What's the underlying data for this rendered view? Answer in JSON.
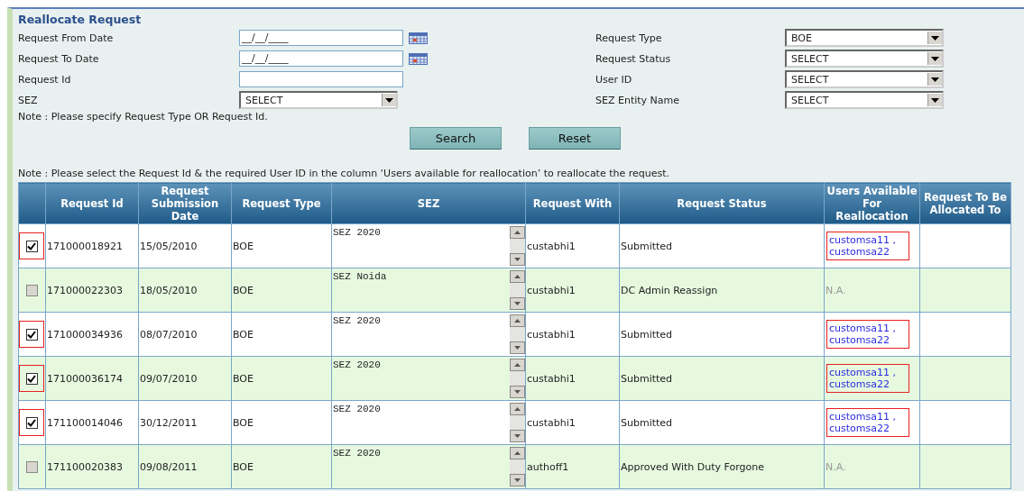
{
  "title": "Reallocate Request",
  "left_fields": [
    {
      "label": "Request From Date",
      "kind": "date",
      "value": "__/__/____"
    },
    {
      "label": "Request To Date",
      "kind": "date",
      "value": "__/__/____"
    },
    {
      "label": "Request Id",
      "kind": "text"
    },
    {
      "label": "SEZ",
      "kind": "select",
      "value": "SELECT"
    }
  ],
  "right_fields": [
    {
      "label": "Request Type",
      "kind": "select",
      "value": "BOE"
    },
    {
      "label": "Request Status",
      "kind": "select",
      "value": "SELECT"
    },
    {
      "label": "User ID",
      "kind": "select",
      "value": "SELECT"
    },
    {
      "label": "SEZ Entity Name",
      "kind": "select",
      "value": "SELECT"
    }
  ],
  "note_top": "Note : Please specify Request Type OR Request Id.",
  "buttons": [
    "Search",
    "Reset"
  ],
  "note_table": "Note : Please select the Request Id & the required User ID in the column ‘Users available for reallocation’ to reallocate the request.",
  "table": {
    "columns": [
      "Request Id",
      "Request Submission Date",
      "Request Type",
      "SEZ",
      "Request With",
      "Request Status",
      "Users Available For Reallocation",
      "Request To Be Allocated To"
    ],
    "rows": [
      {
        "checked": true,
        "id": "171000018921",
        "date": "15/05/2010",
        "type": "BOE",
        "sez": "SEZ 2020",
        "with": "custabhi1",
        "status": "Submitted",
        "users": [
          "customsa11 ,",
          "customsa22"
        ]
      },
      {
        "checked": false,
        "id": "171000022303",
        "date": "18/05/2010",
        "type": "BOE",
        "sez": "SEZ Noida",
        "with": "custabhi1",
        "status": "DC Admin Reassign",
        "users_note": "N.A."
      },
      {
        "checked": true,
        "id": "171000034936",
        "date": "08/07/2010",
        "type": "BOE",
        "sez": "SEZ 2020",
        "with": "custabhi1",
        "status": "Submitted",
        "users": [
          "customsa11 ,",
          "customsa22"
        ]
      },
      {
        "checked": true,
        "id": "171000036174",
        "date": "09/07/2010",
        "type": "BOE",
        "sez": "SEZ 2020",
        "with": "custabhi1",
        "status": "Submitted",
        "users": [
          "customsa11 ,",
          "customsa22"
        ]
      },
      {
        "checked": true,
        "id": "171100014046",
        "date": "30/12/2011",
        "type": "BOE",
        "sez": "SEZ 2020",
        "with": "custabhi1",
        "status": "Submitted",
        "users": [
          "customsa11 ,",
          "customsa22"
        ]
      },
      {
        "checked": false,
        "id": "171100020383",
        "date": "09/08/2011",
        "type": "BOE",
        "sez": "SEZ 2020",
        "with": "authoff1",
        "status": "Approved With Duty Forgone",
        "users_note": "N.A."
      }
    ]
  }
}
